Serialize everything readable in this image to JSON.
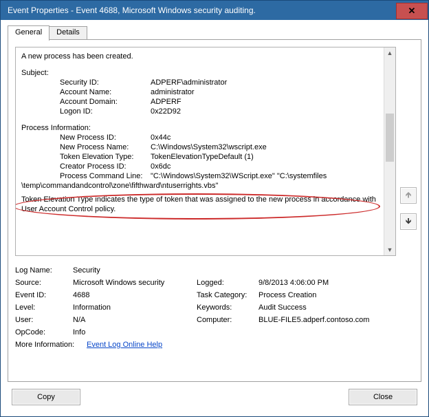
{
  "title": "Event Properties - Event 4688, Microsoft Windows security auditing.",
  "close_glyph": "✕",
  "tabs": {
    "general": "General",
    "details": "Details"
  },
  "detail": {
    "header_line": "A new process has been created.",
    "subject_header": "Subject:",
    "subject": {
      "security_id_label": "Security ID:",
      "security_id_value": "ADPERF\\administrator",
      "account_name_label": "Account Name:",
      "account_name_value": "administrator",
      "account_domain_label": "Account Domain:",
      "account_domain_value": "ADPERF",
      "logon_id_label": "Logon ID:",
      "logon_id_value": "0x22D92"
    },
    "procinfo_header": "Process Information:",
    "procinfo": {
      "new_pid_label": "New Process ID:",
      "new_pid_value": "0x44c",
      "new_pname_label": "New Process Name:",
      "new_pname_value": "C:\\Windows\\System32\\wscript.exe",
      "token_elev_label": "Token Elevation Type:",
      "token_elev_value": "TokenElevationTypeDefault (1)",
      "creator_pid_label": "Creator Process ID:",
      "creator_pid_value": "0x6dc",
      "cmdline_label": "Process Command Line: ",
      "cmdline_value_1": "\"C:\\Windows\\System32\\WScript.exe\" \"C:\\systemfiles",
      "cmdline_value_2": "\\temp\\commandandcontrol\\zone\\fifthward\\ntuserrights.vbs\""
    },
    "footer": "Token Elevation Type indicates the type of token that was assigned to the new process in accordance with User Account Control policy."
  },
  "meta": {
    "log_name_label": "Log Name:",
    "log_name_value": "Security",
    "source_label": "Source:",
    "source_value": "Microsoft Windows security",
    "logged_label": "Logged:",
    "logged_value": "9/8/2013 4:06:00 PM",
    "event_id_label": "Event ID:",
    "event_id_value": "4688",
    "task_cat_label": "Task Category:",
    "task_cat_value": "Process Creation",
    "level_label": "Level:",
    "level_value": "Information",
    "keywords_label": "Keywords:",
    "keywords_value": "Audit Success",
    "user_label": "User:",
    "user_value": "N/A",
    "computer_label": "Computer:",
    "computer_value": "BLUE-FILE5.adperf.contoso.com",
    "opcode_label": "OpCode:",
    "opcode_value": "Info",
    "moreinfo_label": "More Information:",
    "moreinfo_link": "Event Log Online Help"
  },
  "nav": {
    "up_tip": "▲",
    "down_tip": "▼"
  },
  "buttons": {
    "copy": "Copy",
    "close": "Close"
  }
}
